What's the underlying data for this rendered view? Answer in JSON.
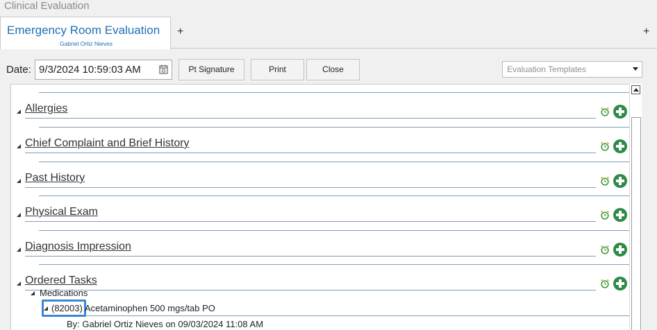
{
  "app": {
    "title": "Clinical Evaluation"
  },
  "tabs": [
    {
      "title": "Emergency Room Evaluation",
      "subtitle": "Gabriel Ortiz Nieves"
    }
  ],
  "tab_add_label": "+",
  "toolbar": {
    "date_label": "Date:",
    "date_value": "9/3/2024 10:59:03 AM",
    "pt_signature_label": "Pt Signature",
    "print_label": "Print",
    "close_label": "Close",
    "templates_placeholder": "Evaluation Templates"
  },
  "sections": [
    {
      "title": "Allergies"
    },
    {
      "title": "Chief Complaint and Brief History"
    },
    {
      "title": "Past History"
    },
    {
      "title": "Physical Exam"
    },
    {
      "title": "Diagnosis Impression"
    },
    {
      "title": "Ordered Tasks"
    }
  ],
  "ordered_tasks": {
    "group_label": "Medications",
    "item": {
      "code": "(82003)",
      "name": "Acetaminophen 500 mgs/tab PO",
      "by": "By: Gabriel Ortiz Nieves on 09/03/2024 11:08 AM"
    }
  },
  "colors": {
    "accent": "#1f6fb5",
    "add_button": "#2e8b47",
    "alarm": "#3a9a3a",
    "highlight": "#3a86d6"
  }
}
